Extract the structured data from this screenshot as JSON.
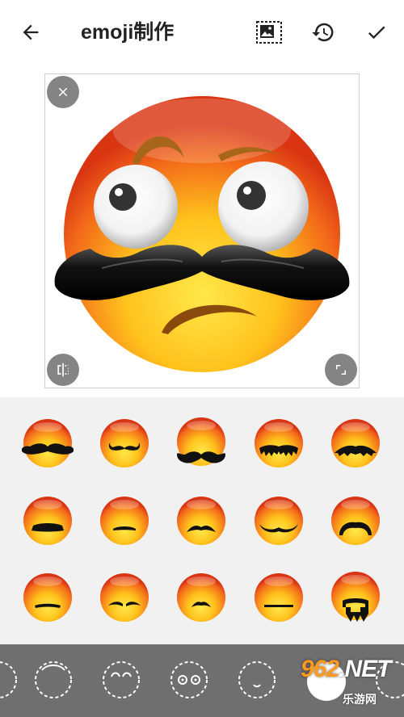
{
  "app": {
    "title": "emoji制作"
  },
  "toolbar": {
    "back_icon": "arrow-left-icon",
    "background_icon": "image-frame-icon",
    "history_icon": "history-icon",
    "confirm_icon": "check-icon"
  },
  "canvas": {
    "close_icon": "close-icon",
    "flip_icon": "flip-horizontal-icon",
    "resize_icon": "resize-icon"
  },
  "picker": {
    "items": [
      "mustache-handlebar-wide",
      "mustache-small-curl",
      "mustache-large-curl",
      "mustache-droopy",
      "mustache-wide-bushy",
      "mustache-thick-flat",
      "mustache-thin-flat",
      "mustache-chevron",
      "mustache-wide-thin",
      "mustache-horseshoe",
      "mustache-pencil",
      "mustache-split-thin",
      "mustache-small-arch",
      "mustache-flat-line",
      "mustache-goatee"
    ]
  },
  "categories": {
    "items": [
      "face-outline",
      "face-brows",
      "face-eyes",
      "face-mouth",
      "face-mustache",
      "face-more"
    ],
    "active_index": 4
  },
  "watermark": {
    "brand_number": "962",
    "brand_suffix": ".NET",
    "subtitle": "乐游网"
  },
  "colors": {
    "accent_bar": "#6f6f6f",
    "picker_bg": "#f1f1f1"
  }
}
